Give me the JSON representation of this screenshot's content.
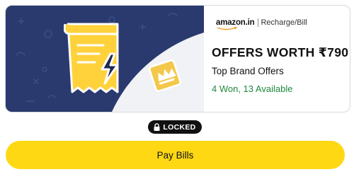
{
  "offer_card": {
    "brand": {
      "logo_text": "amazon.in",
      "category": "Recharge/Bill"
    },
    "title": "OFFERS WORTH ₹790",
    "subtitle": "Top Brand Offers",
    "status": "4 Won, 13 Available",
    "icons": {
      "bill": "bill-with-lightning-icon",
      "badge": "crown-badge-icon"
    }
  },
  "lock_badge": {
    "label": "LOCKED",
    "icon": "lock-icon"
  },
  "pay_button": {
    "label": "Pay Bills"
  },
  "colors": {
    "banner_bg": "#2a3a6e",
    "accent_yellow": "#ffd814",
    "status_green": "#1d8a3c",
    "pill_bg": "#111111"
  }
}
